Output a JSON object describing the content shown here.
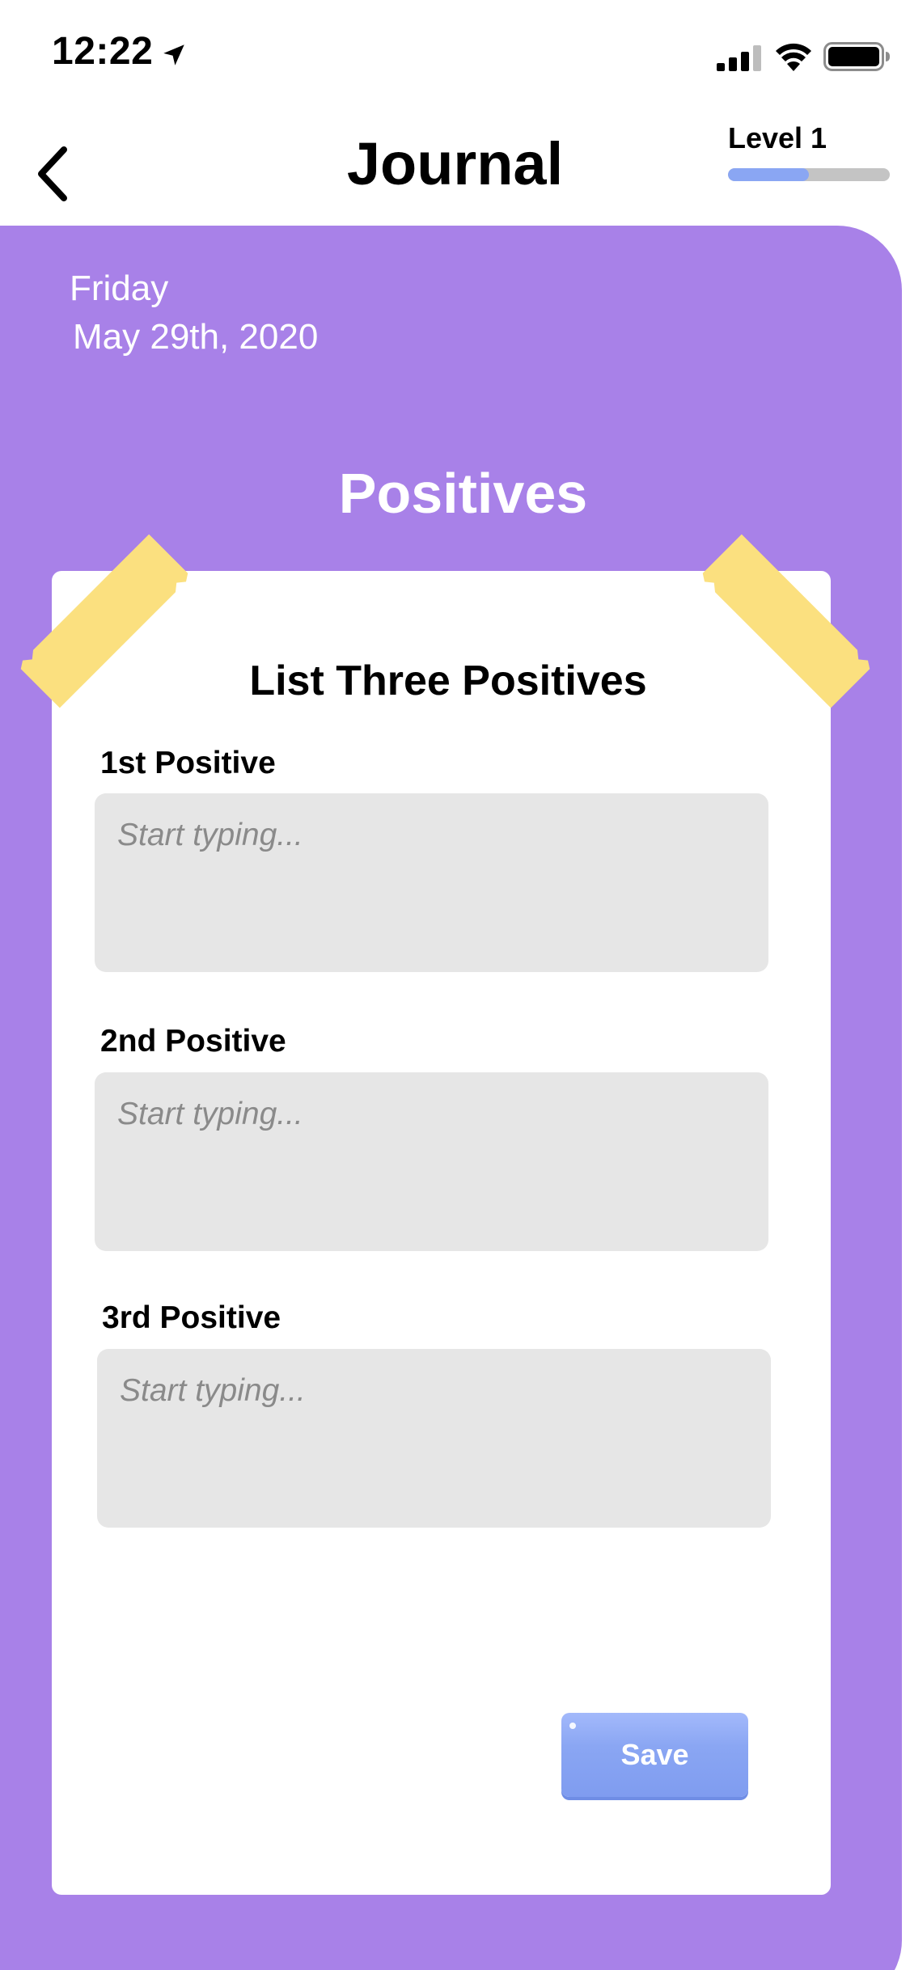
{
  "status_bar": {
    "time": "12:22",
    "icons": [
      "location-arrow-icon",
      "cellular-signal-icon",
      "wifi-icon",
      "battery-icon"
    ]
  },
  "header": {
    "title": "Journal",
    "back_icon": "chevron-left-icon",
    "level_label": "Level 1",
    "level_progress": 0.5
  },
  "journal": {
    "day": "Friday",
    "date": "May 29th, 2020",
    "section_title": "Positives"
  },
  "card": {
    "title": "List Three Positives",
    "fields": [
      {
        "label": "1st Positive",
        "placeholder": "Start typing...",
        "value": ""
      },
      {
        "label": "2nd Positive",
        "placeholder": "Start typing...",
        "value": ""
      },
      {
        "label": "3rd Positive",
        "placeholder": "Start typing...",
        "value": ""
      }
    ],
    "save_label": "Save"
  },
  "colors": {
    "panel": "#a881e8",
    "tape": "#fbe07f",
    "accent": "#8aa6f3",
    "input_bg": "#e6e6e6",
    "progress_track": "#c4c4c4"
  }
}
